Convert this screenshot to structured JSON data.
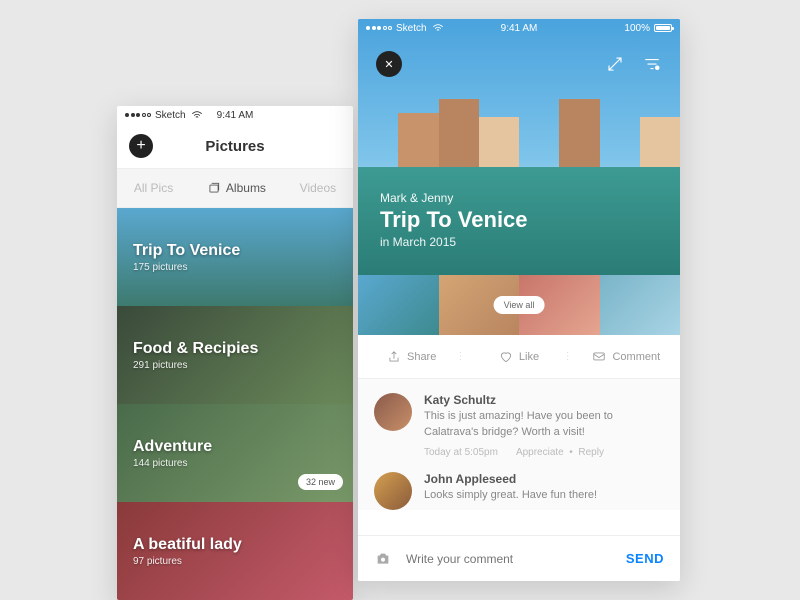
{
  "status": {
    "carrier": "Sketch",
    "time": "9:41 AM",
    "battery": "100%"
  },
  "left": {
    "title": "Pictures",
    "tabs": {
      "all": "All Pics",
      "albums": "Albums",
      "videos": "Videos"
    },
    "albums": [
      {
        "title": "Trip To Venice",
        "sub": "175 pictures"
      },
      {
        "title": "Food & Recipies",
        "sub": "291 pictures"
      },
      {
        "title": "Adventure",
        "sub": "144 pictures",
        "badge": "32 new"
      },
      {
        "title": "A beatiful lady",
        "sub": "97 pictures"
      }
    ]
  },
  "right": {
    "hero": {
      "author": "Mark & Jenny",
      "title": "Trip To Venice",
      "date": "in March 2015"
    },
    "viewall": "View all",
    "actions": {
      "share": "Share",
      "like": "Like",
      "comment": "Comment"
    },
    "comments": [
      {
        "name": "Katy Schultz",
        "text": "This is just amazing! Have you been to Calatrava's bridge? Worth a visit!",
        "time": "Today at 5:05pm",
        "appreciate": "Appreciate",
        "reply": "Reply"
      },
      {
        "name": "John Appleseed",
        "text": "Looks simply great. Have fun there!"
      }
    ],
    "composer": {
      "placeholder": "Write your comment",
      "send": "SEND"
    }
  }
}
